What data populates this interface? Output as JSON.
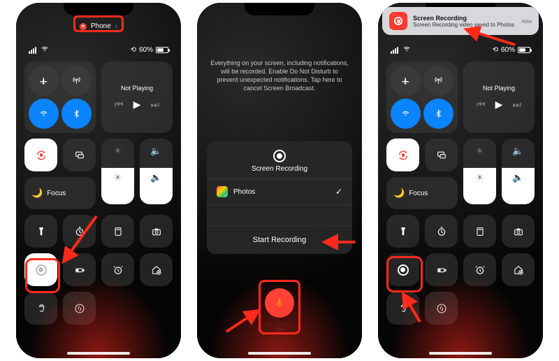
{
  "panel1": {
    "pill_label": "Phone",
    "battery_pct": "60%",
    "media_label": "Not Playing",
    "focus_label": "Focus"
  },
  "panel2": {
    "warning": "Everything on your screen, including notifications, will be recorded. Enable Do Not Disturb to prevent unexpected notifications. Tap here to cancel Screen Broadcast.",
    "card_title": "Screen Recording",
    "app_name": "Photos",
    "start_label": "Start Recording",
    "mic_label": "Microphone",
    "mic_state": "On"
  },
  "panel3": {
    "battery_pct": "60%",
    "media_label": "Not Playing",
    "focus_label": "Focus",
    "banner_title": "Screen Recording",
    "banner_sub": "Screen Recording video saved to Photos",
    "banner_time": "now"
  }
}
